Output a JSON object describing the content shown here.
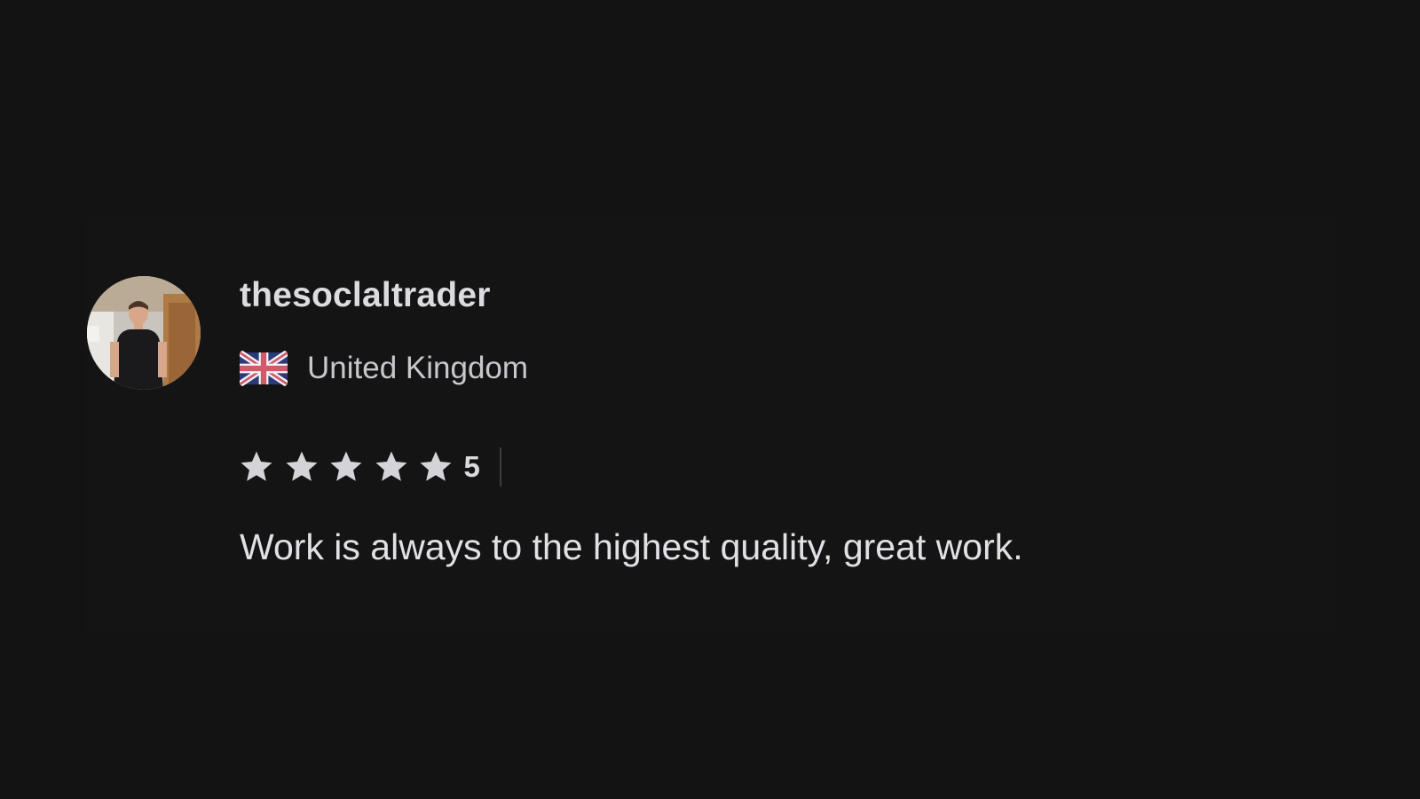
{
  "review": {
    "username": "thesoclaltrader",
    "country": "United Kingdom",
    "flag_icon": "uk-flag-icon",
    "avatar_icon": "user-avatar",
    "rating": {
      "value": "5",
      "max_stars": 5,
      "filled_stars": 5,
      "star_color": "#d4d4d8"
    },
    "text": "Work is always to the highest quality, great work."
  },
  "colors": {
    "background": "#131313",
    "text_primary": "#dcdce0",
    "text_secondary": "#c7c7cc"
  }
}
